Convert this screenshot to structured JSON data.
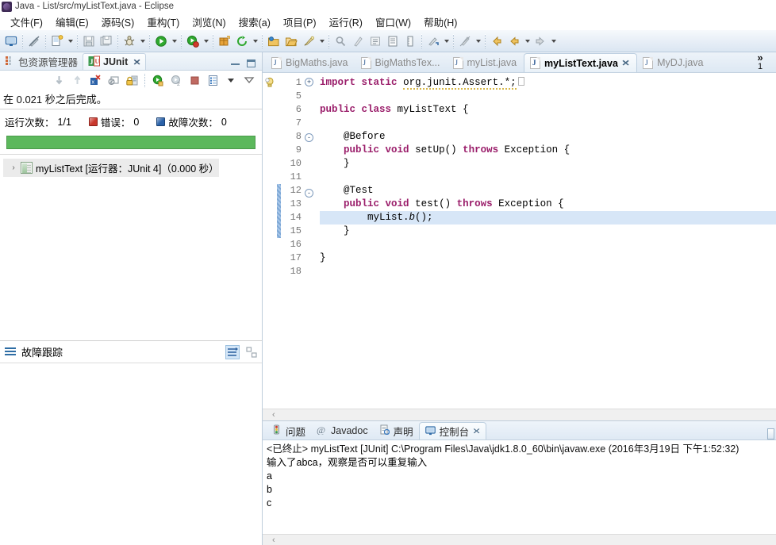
{
  "window": {
    "title": "Java - List/src/myListText.java - Eclipse",
    "app_icon": "eclipse-icon"
  },
  "menubar": {
    "items": [
      {
        "label": "文件(F)",
        "name": "menu-file"
      },
      {
        "label": "编辑(E)",
        "name": "menu-edit"
      },
      {
        "label": "源码(S)",
        "name": "menu-source"
      },
      {
        "label": "重构(T)",
        "name": "menu-refactor"
      },
      {
        "label": "浏览(N)",
        "name": "menu-navigate"
      },
      {
        "label": "搜索(a)",
        "name": "menu-search"
      },
      {
        "label": "项目(P)",
        "name": "menu-project"
      },
      {
        "label": "运行(R)",
        "name": "menu-run"
      },
      {
        "label": "窗口(W)",
        "name": "menu-window"
      },
      {
        "label": "帮助(H)",
        "name": "menu-help"
      }
    ]
  },
  "toolbar": {
    "buttons": [
      {
        "name": "open-perspective-icon",
        "glyph": "monitor"
      },
      {
        "name": "toggle-mark-occurrences-icon",
        "glyph": "pen-slash"
      },
      {
        "name": "new-wizard-icon",
        "glyph": "new-file"
      },
      {
        "name": "save-icon",
        "glyph": "save"
      },
      {
        "name": "save-all-icon",
        "glyph": "save-all"
      },
      {
        "name": "debug-icon",
        "glyph": "bug"
      },
      {
        "name": "run-icon",
        "glyph": "run-green"
      },
      {
        "name": "run-last-tool-icon",
        "glyph": "run-red"
      },
      {
        "name": "new-java-package-icon",
        "glyph": "package"
      },
      {
        "name": "external-tools-icon",
        "glyph": "refresh-green"
      },
      {
        "name": "new-java-project-icon",
        "glyph": "folder-yellow"
      },
      {
        "name": "open-type-icon",
        "glyph": "folder-open"
      },
      {
        "name": "quick-fix-icon",
        "glyph": "pencil"
      },
      {
        "name": "search-icon",
        "glyph": "magnifier"
      },
      {
        "name": "annotation-icon",
        "glyph": "annotation"
      },
      {
        "name": "toggle-block-icon",
        "glyph": "block"
      },
      {
        "name": "outline-icon",
        "glyph": "outline"
      },
      {
        "name": "ruler-icon",
        "glyph": "ruler"
      },
      {
        "name": "next-annotation-icon",
        "glyph": "next-ann"
      },
      {
        "name": "previous-edit-icon",
        "glyph": "prev-edit"
      },
      {
        "name": "back-icon",
        "glyph": "back-yellow"
      },
      {
        "name": "back-nav-icon",
        "glyph": "back-arrow"
      },
      {
        "name": "forward-nav-icon",
        "glyph": "forward-arrow"
      }
    ]
  },
  "junit_view": {
    "tabs": [
      {
        "label": "包资源管理器",
        "name": "view-tab-package-explorer",
        "active": false
      },
      {
        "label": "JUnit",
        "name": "view-tab-junit",
        "active": true
      }
    ],
    "close_glyph": "✕",
    "view_controls": [
      {
        "name": "minimize-view-button"
      },
      {
        "name": "maximize-view-button"
      }
    ],
    "toolbar_buttons": [
      {
        "name": "next-failed-test-button",
        "glyph": "arrow-down"
      },
      {
        "name": "previous-failed-test-button",
        "glyph": "arrow-up"
      },
      {
        "name": "show-failures-only-button",
        "glyph": "filter-failures"
      },
      {
        "name": "stop-junit-button",
        "glyph": "stop"
      },
      {
        "name": "lock-scroll-button",
        "glyph": "lock"
      },
      {
        "name": "rerun-test-button",
        "glyph": "rerun"
      },
      {
        "name": "rerun-failed-tests-button",
        "glyph": "rerun-failed"
      },
      {
        "name": "terminate-button",
        "glyph": "stop-red"
      },
      {
        "name": "test-run-history-button",
        "glyph": "history"
      },
      {
        "name": "history-dropdown-button",
        "glyph": "chevron-down"
      },
      {
        "name": "view-menu-button",
        "glyph": "view-menu"
      }
    ],
    "status_text": "在 0.021 秒之后完成。",
    "counters": [
      {
        "label": "运行次数：",
        "value": "1/1",
        "icon": null,
        "name": "runs-counter"
      },
      {
        "label": "错误：",
        "value": "0",
        "icon": "errors-icon",
        "name": "errors-counter"
      },
      {
        "label": "故障次数：",
        "value": "0",
        "icon": "failures-icon",
        "name": "failures-counter"
      }
    ],
    "progress": {
      "percent": 100,
      "color": "#5cb85c"
    },
    "tree": [
      {
        "twisty": "›",
        "icon": "test-class-icon",
        "label": "myListText [运行器：JUnit 4]（0.000 秒）",
        "name": "junit-tree-item-mylisttext"
      }
    ],
    "failure_trace": {
      "label": "故障跟踪",
      "icon": "hamburger-icon",
      "buttons": [
        {
          "name": "filter-stack-trace-button",
          "glyph": "filter-stack",
          "selected": true
        },
        {
          "name": "compare-result-button",
          "glyph": "compare"
        }
      ]
    }
  },
  "editor": {
    "tabs": [
      {
        "label": "BigMaths.java",
        "name": "editor-tab-bigmaths",
        "active": false,
        "icon": "java-file-icon"
      },
      {
        "label": "BigMathsTex...",
        "name": "editor-tab-bigmathstext",
        "active": false,
        "icon": "java-file-icon"
      },
      {
        "label": "myList.java",
        "name": "editor-tab-mylist",
        "active": false,
        "icon": "java-file-icon"
      },
      {
        "label": "myListText.java",
        "name": "editor-tab-mylisttext",
        "active": true,
        "icon": "java-file-warning-icon"
      },
      {
        "label": "MyDJ.java",
        "name": "editor-tab-mydj",
        "active": false,
        "icon": "java-file-icon"
      }
    ],
    "close_glyph": "✕",
    "overflow": {
      "chevron": "»",
      "count": "1"
    },
    "gutter_warning_icon": "warning-lightbulb-icon",
    "lines": [
      {
        "no": "1",
        "fold": "+",
        "tokens": [
          {
            "t": "import",
            "c": "kw"
          },
          {
            "t": " ",
            "c": ""
          },
          {
            "t": "static",
            "c": "kw"
          },
          {
            "t": " ",
            "c": ""
          },
          {
            "t": "org.junit.Assert.*;",
            "c": "und"
          }
        ],
        "box": true,
        "hl": false
      },
      {
        "no": "5",
        "fold": "",
        "tokens": [],
        "hl": false
      },
      {
        "no": "6",
        "fold": "",
        "tokens": [
          {
            "t": "public",
            "c": "kw"
          },
          {
            "t": " ",
            "c": ""
          },
          {
            "t": "class",
            "c": "kw"
          },
          {
            "t": " myListText {",
            "c": ""
          }
        ],
        "hl": false
      },
      {
        "no": "7",
        "fold": "",
        "tokens": [],
        "hl": false
      },
      {
        "no": "8",
        "fold": "-",
        "tokens": [
          {
            "t": "    @Before",
            "c": ""
          }
        ],
        "hl": false
      },
      {
        "no": "9",
        "fold": "",
        "tokens": [
          {
            "t": "    ",
            "c": ""
          },
          {
            "t": "public",
            "c": "kw"
          },
          {
            "t": " ",
            "c": ""
          },
          {
            "t": "void",
            "c": "kw"
          },
          {
            "t": " setUp() ",
            "c": ""
          },
          {
            "t": "throws",
            "c": "kw"
          },
          {
            "t": " Exception {",
            "c": ""
          }
        ],
        "hl": false
      },
      {
        "no": "10",
        "fold": "",
        "tokens": [
          {
            "t": "    }",
            "c": ""
          }
        ],
        "hl": false
      },
      {
        "no": "11",
        "fold": "",
        "tokens": [],
        "hl": false
      },
      {
        "no": "12",
        "fold": "-",
        "tokens": [
          {
            "t": "    @Test",
            "c": ""
          }
        ],
        "hl": false
      },
      {
        "no": "13",
        "fold": "",
        "tokens": [
          {
            "t": "    ",
            "c": ""
          },
          {
            "t": "public",
            "c": "kw"
          },
          {
            "t": " ",
            "c": ""
          },
          {
            "t": "void",
            "c": "kw"
          },
          {
            "t": " test() ",
            "c": ""
          },
          {
            "t": "throws",
            "c": "kw"
          },
          {
            "t": " Exception {",
            "c": ""
          }
        ],
        "hl": false
      },
      {
        "no": "14",
        "fold": "",
        "tokens": [
          {
            "t": "        myList.",
            "c": ""
          },
          {
            "t": "b",
            "c": "ital"
          },
          {
            "t": "();",
            "c": ""
          }
        ],
        "hl": true
      },
      {
        "no": "15",
        "fold": "",
        "tokens": [
          {
            "t": "    }",
            "c": ""
          }
        ],
        "hl": false
      },
      {
        "no": "16",
        "fold": "",
        "tokens": [],
        "hl": false
      },
      {
        "no": "17",
        "fold": "",
        "tokens": [
          {
            "t": "}",
            "c": ""
          }
        ],
        "hl": false
      },
      {
        "no": "18",
        "fold": "",
        "tokens": [],
        "hl": false
      }
    ],
    "change_marker": {
      "start_line_index": 8,
      "end_line_index": 11
    },
    "hscroll_arrow": "‹"
  },
  "bottom_panel": {
    "tabs": [
      {
        "label": "问题",
        "name": "bottom-tab-problems",
        "icon": "problems-icon",
        "active": false
      },
      {
        "label": "Javadoc",
        "name": "bottom-tab-javadoc",
        "icon": "javadoc-icon",
        "active": false
      },
      {
        "label": "声明",
        "name": "bottom-tab-declaration",
        "icon": "declaration-icon",
        "active": false
      },
      {
        "label": "控制台",
        "name": "bottom-tab-console",
        "icon": "console-icon",
        "active": true
      }
    ],
    "close_glyph": "✕",
    "console_lines": [
      "<已终止> myListText [JUnit] C:\\Program Files\\Java\\jdk1.8.0_60\\bin\\javaw.exe (2016年3月19日 下午1:52:32)",
      "输入了abca，观察是否可以重复输入",
      "a",
      "b",
      "c"
    ],
    "hscroll_arrow": "‹"
  },
  "colors": {
    "progress_green": "#5cb85c",
    "keyword_purple": "#9a1d6a",
    "line_highlight": "#d7e6f7",
    "error_red": "#c9372c",
    "failure_blue": "#2a61a8"
  }
}
